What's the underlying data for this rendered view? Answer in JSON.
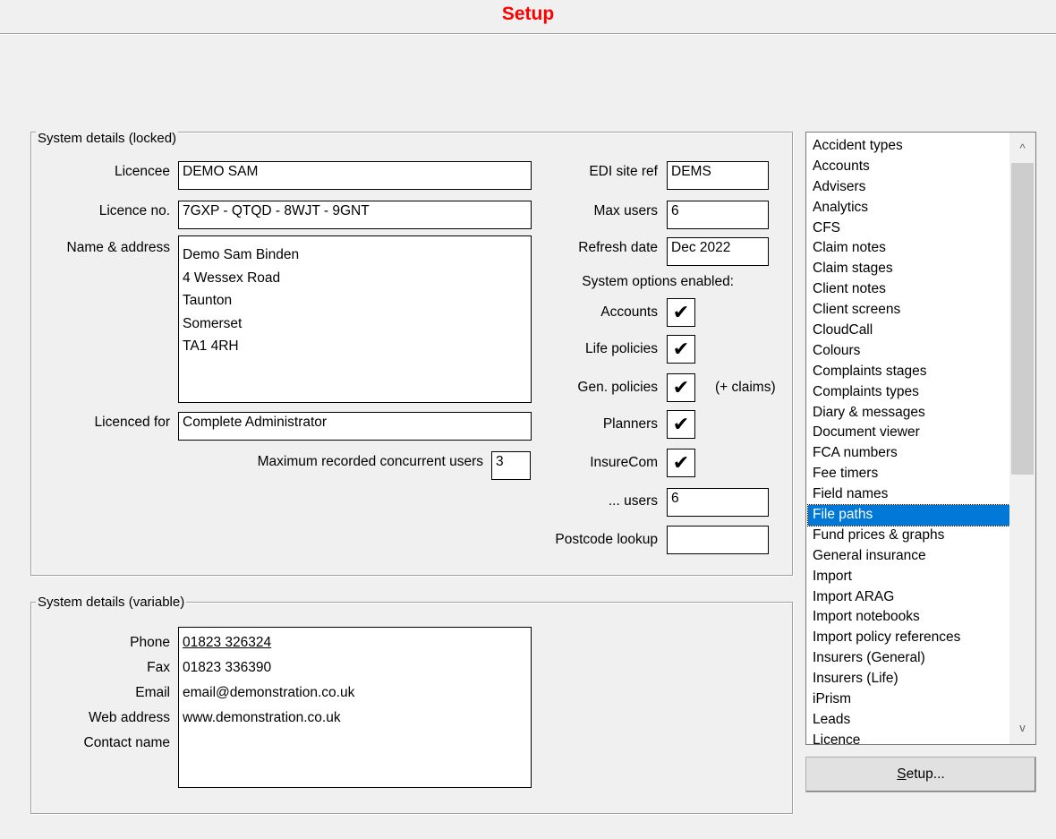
{
  "header": {
    "title": "Setup"
  },
  "locked": {
    "caption": "System details (locked)",
    "licencee_label": "Licencee",
    "licencee": "DEMO SAM",
    "licence_no_label": "Licence no.",
    "licence_no": "7GXP - QTQD - 8WJT - 9GNT",
    "address_label": "Name & address",
    "address": [
      "Demo Sam Binden",
      "4 Wessex Road",
      "Taunton",
      "Somerset",
      "TA1 4RH"
    ],
    "licenced_for_label": "Licenced for",
    "licenced_for": "Complete Administrator",
    "max_recorded_label": "Maximum recorded concurrent users",
    "max_recorded": "3",
    "edi_label": "EDI site ref",
    "edi": "DEMS",
    "max_users_label": "Max users",
    "max_users": "6",
    "refresh_label": "Refresh date",
    "refresh": "Dec 2022",
    "options_label": "System options enabled:",
    "options": {
      "accounts": "Accounts",
      "life": "Life policies",
      "gen": "Gen. policies",
      "gen_note": "(+ claims)",
      "planners": "Planners",
      "insurecom": "InsureCom",
      "check": "✔"
    },
    "users_label": "... users",
    "users": "6",
    "postcode_label": "Postcode lookup",
    "postcode": ""
  },
  "variable": {
    "caption": "System details (variable)",
    "phone_label": "Phone",
    "phone": "01823 326324",
    "fax_label": "Fax",
    "fax": "01823 336390",
    "email_label": "Email",
    "email": "email@demonstration.co.uk",
    "web_label": "Web address",
    "web": "www.demonstration.co.uk",
    "contact_label": "Contact name",
    "contact": ""
  },
  "list": {
    "items": [
      "Accident types",
      "Accounts",
      "Advisers",
      "Analytics",
      "CFS",
      "Claim notes",
      "Claim stages",
      "Client notes",
      "Client screens",
      "CloudCall",
      "Colours",
      "Complaints stages",
      "Complaints types",
      "Diary & messages",
      "Document viewer",
      "FCA numbers",
      "Fee timers",
      "Field names",
      "File paths",
      "Fund prices & graphs",
      "General insurance",
      "Import",
      "Import ARAG",
      "Import notebooks",
      "Import policy references",
      "Insurers (General)",
      "Insurers (Life)",
      "iPrism",
      "Leads",
      "Licence"
    ],
    "selected": "File paths",
    "scroll_up": "^",
    "scroll_down": "v"
  },
  "setup_button": {
    "label_prefix": "S",
    "label_rest": "etup..."
  }
}
